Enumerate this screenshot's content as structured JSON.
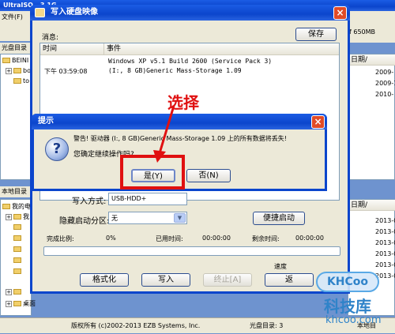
{
  "background_app": {
    "title_fragment": "UltraISO - 3.1G - ...",
    "menu_file": "文件(F)",
    "size_indicator": "f 650MB",
    "disc_dir_label": "光盘目录",
    "local_dir_label": "本地目录",
    "top_tree": [
      "BEINI",
      "bo",
      "to"
    ],
    "local_tree": [
      "我的电",
      "我",
      "桌面"
    ],
    "date_header": "日期/",
    "dates_top": [
      "2009-",
      "2009-1",
      "2010-"
    ],
    "dates_bottom": [
      "2013-0",
      "2013-0",
      "2013-0",
      "2013-0",
      "2013-0",
      "2013-0"
    ],
    "status_copyright": "版权所有 (c)2002-2013 EZB Systems, Inc.",
    "status_disc": "光盘目录: 3",
    "status_local": "本地目"
  },
  "write_dialog": {
    "title": "写入硬盘映像",
    "message_label": "消息:",
    "save_button": "保存",
    "col_time": "时间",
    "col_event": "事件",
    "log": [
      {
        "time": "",
        "event": "Windows XP v5.1 Build 2600 (Service Pack 3)"
      },
      {
        "time": "下午 03:59:08",
        "event": "(I:, 8 GB)Generic Mass-Storage    1.09"
      }
    ],
    "write_method_label": "写入方式:",
    "write_method_value": "USB-HDD+",
    "hidden_partition_label": "隐藏启动分区:",
    "hidden_partition_value": "无",
    "quick_boot_button": "便捷启动",
    "progress_label": "完成比例:",
    "progress_value": "0%",
    "elapsed_label": "已用时间:",
    "elapsed_value": "00:00:00",
    "remaining_label": "剩余时间:",
    "remaining_value": "00:00:00",
    "speed_label": "速度",
    "format_button": "格式化",
    "write_button": "写入",
    "stop_button": "终止[A]",
    "back_button": "返"
  },
  "prompt_dialog": {
    "title": "提示",
    "warning_text": "警告! 驱动器 (I:, 8 GB)Generic Mass-Storage    1.09 上的所有数据将丢失!",
    "question_text": "您确定继续操作吗?",
    "yes_button": "是(Y)",
    "no_button": "否(N)",
    "icon": "question-icon"
  },
  "annotation": {
    "label": "选择",
    "color": "#e01010"
  },
  "watermark": {
    "logo_text": "KHCoo",
    "brand_cn": "科技库",
    "url": "khcoo.com"
  }
}
